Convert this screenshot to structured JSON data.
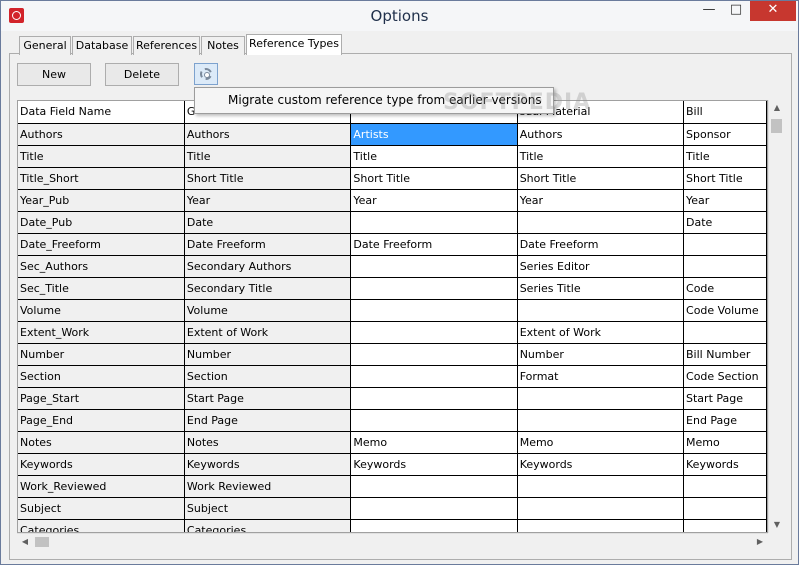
{
  "window": {
    "title": "Options"
  },
  "tabs": [
    "General",
    "Database",
    "References",
    "Notes",
    "Reference Types"
  ],
  "active_tab": "Reference Types",
  "toolbar": {
    "new_label": "New",
    "delete_label": "Delete"
  },
  "tooltip": "Migrate custom reference type from earlier versions",
  "watermark": "SOFTPEDIA",
  "grid": {
    "headers": [
      "Data Field Name",
      "G",
      "",
      "sual Material",
      "Bill"
    ],
    "rows": [
      [
        "Authors",
        "Authors",
        "Artists",
        "Authors",
        "Sponsor"
      ],
      [
        "Title",
        "Title",
        "Title",
        "Title",
        "Title"
      ],
      [
        "Title_Short",
        "Short Title",
        "Short Title",
        "Short Title",
        "Short Title"
      ],
      [
        "Year_Pub",
        "Year",
        "Year",
        "Year",
        "Year"
      ],
      [
        "Date_Pub",
        "Date",
        "",
        "",
        "Date"
      ],
      [
        "Date_Freeform",
        "Date Freeform",
        "Date Freeform",
        "Date Freeform",
        ""
      ],
      [
        "Sec_Authors",
        "Secondary Authors",
        "",
        "Series Editor",
        ""
      ],
      [
        "Sec_Title",
        "Secondary Title",
        "",
        "Series Title",
        "Code"
      ],
      [
        "Volume",
        "Volume",
        "",
        "",
        "Code Volume"
      ],
      [
        "Extent_Work",
        "Extent of Work",
        "",
        "Extent of Work",
        ""
      ],
      [
        "Number",
        "Number",
        "",
        "Number",
        "Bill Number"
      ],
      [
        "Section",
        "Section",
        "",
        "Format",
        "Code Section"
      ],
      [
        "Page_Start",
        "Start Page",
        "",
        "",
        "Start Page"
      ],
      [
        "Page_End",
        "End Page",
        "",
        "",
        "End Page"
      ],
      [
        "Notes",
        "Notes",
        "Memo",
        "Memo",
        "Memo"
      ],
      [
        "Keywords",
        "Keywords",
        "Keywords",
        "Keywords",
        "Keywords"
      ],
      [
        "Work_Reviewed",
        "Work Reviewed",
        "",
        "",
        ""
      ],
      [
        "Subject",
        "Subject",
        "",
        "",
        ""
      ],
      [
        "Categories",
        "Categories",
        "",
        "",
        ""
      ]
    ],
    "selected_cell": {
      "row": 0,
      "col": 2
    }
  }
}
